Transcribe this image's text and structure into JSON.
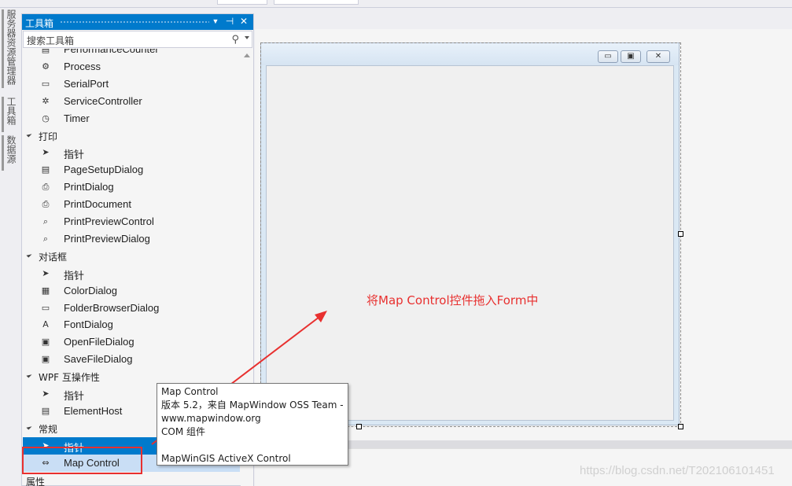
{
  "side_tabs": [
    "服务器资源管理器",
    "工具箱",
    "数据源"
  ],
  "toolbox": {
    "title": "工具箱",
    "pin_glyph": "⊣",
    "close_glyph": "✕",
    "search_placeholder": "搜索工具箱",
    "search_icon": "search-icon",
    "items": [
      {
        "kind": "item",
        "label": "PerformanceCounter",
        "icon": "counter-icon",
        "glyph": "▤"
      },
      {
        "kind": "item",
        "label": "Process",
        "icon": "gears-icon",
        "glyph": "⚙"
      },
      {
        "kind": "item",
        "label": "SerialPort",
        "icon": "serial-port-icon",
        "glyph": "▭"
      },
      {
        "kind": "item",
        "label": "ServiceController",
        "icon": "service-gear-icon",
        "glyph": "✲"
      },
      {
        "kind": "item",
        "label": "Timer",
        "icon": "stopwatch-icon",
        "glyph": "◷"
      },
      {
        "kind": "category",
        "label": "打印"
      },
      {
        "kind": "item",
        "label": "指针",
        "icon": "pointer-icon",
        "glyph": "➤"
      },
      {
        "kind": "item",
        "label": "PageSetupDialog",
        "icon": "page-setup-icon",
        "glyph": "▤"
      },
      {
        "kind": "item",
        "label": "PrintDialog",
        "icon": "printer-icon",
        "glyph": "⎙"
      },
      {
        "kind": "item",
        "label": "PrintDocument",
        "icon": "print-document-icon",
        "glyph": "⎙"
      },
      {
        "kind": "item",
        "label": "PrintPreviewControl",
        "icon": "print-preview-control-icon",
        "glyph": "⌕"
      },
      {
        "kind": "item",
        "label": "PrintPreviewDialog",
        "icon": "print-preview-dialog-icon",
        "glyph": "⌕"
      },
      {
        "kind": "category",
        "label": "对话框"
      },
      {
        "kind": "item",
        "label": "指针",
        "icon": "pointer-icon",
        "glyph": "➤"
      },
      {
        "kind": "item",
        "label": "ColorDialog",
        "icon": "color-dialog-icon",
        "glyph": "▦"
      },
      {
        "kind": "item",
        "label": "FolderBrowserDialog",
        "icon": "folder-icon",
        "glyph": "▭"
      },
      {
        "kind": "item",
        "label": "FontDialog",
        "icon": "font-dialog-icon",
        "glyph": "A"
      },
      {
        "kind": "item",
        "label": "OpenFileDialog",
        "icon": "open-file-icon",
        "glyph": "▣"
      },
      {
        "kind": "item",
        "label": "SaveFileDialog",
        "icon": "save-file-icon",
        "glyph": "▣"
      },
      {
        "kind": "category",
        "label": "WPF 互操作性"
      },
      {
        "kind": "item",
        "label": "指针",
        "icon": "pointer-icon",
        "glyph": "➤"
      },
      {
        "kind": "item",
        "label": "ElementHost",
        "icon": "element-host-icon",
        "glyph": "▤"
      },
      {
        "kind": "category",
        "label": "常规"
      },
      {
        "kind": "item",
        "label": "指针",
        "icon": "pointer-icon",
        "glyph": "➤",
        "state": "selected"
      },
      {
        "kind": "item",
        "label": "Map Control",
        "icon": "activex-control-icon",
        "glyph": "⇔",
        "state": "hover"
      }
    ]
  },
  "form": {
    "minimize_glyph": "▭",
    "maximize_glyph": "▣",
    "close_glyph": "✕"
  },
  "annotation": {
    "text": "将Map Control控件拖入Form中",
    "color": "#e8302f"
  },
  "tooltip": {
    "lines": [
      "Map Control",
      "版本 5.2，来自 MapWindow OSS Team -",
      "www.mapwindow.org",
      "COM 组件",
      "",
      "MapWinGIS ActiveX Control"
    ]
  },
  "properties_label": "属性",
  "watermark": "https://blog.csdn.net/T202106101451",
  "colors": {
    "accent": "#007acc",
    "highlight": "#c9def5",
    "annotation_red": "#e8302f"
  }
}
